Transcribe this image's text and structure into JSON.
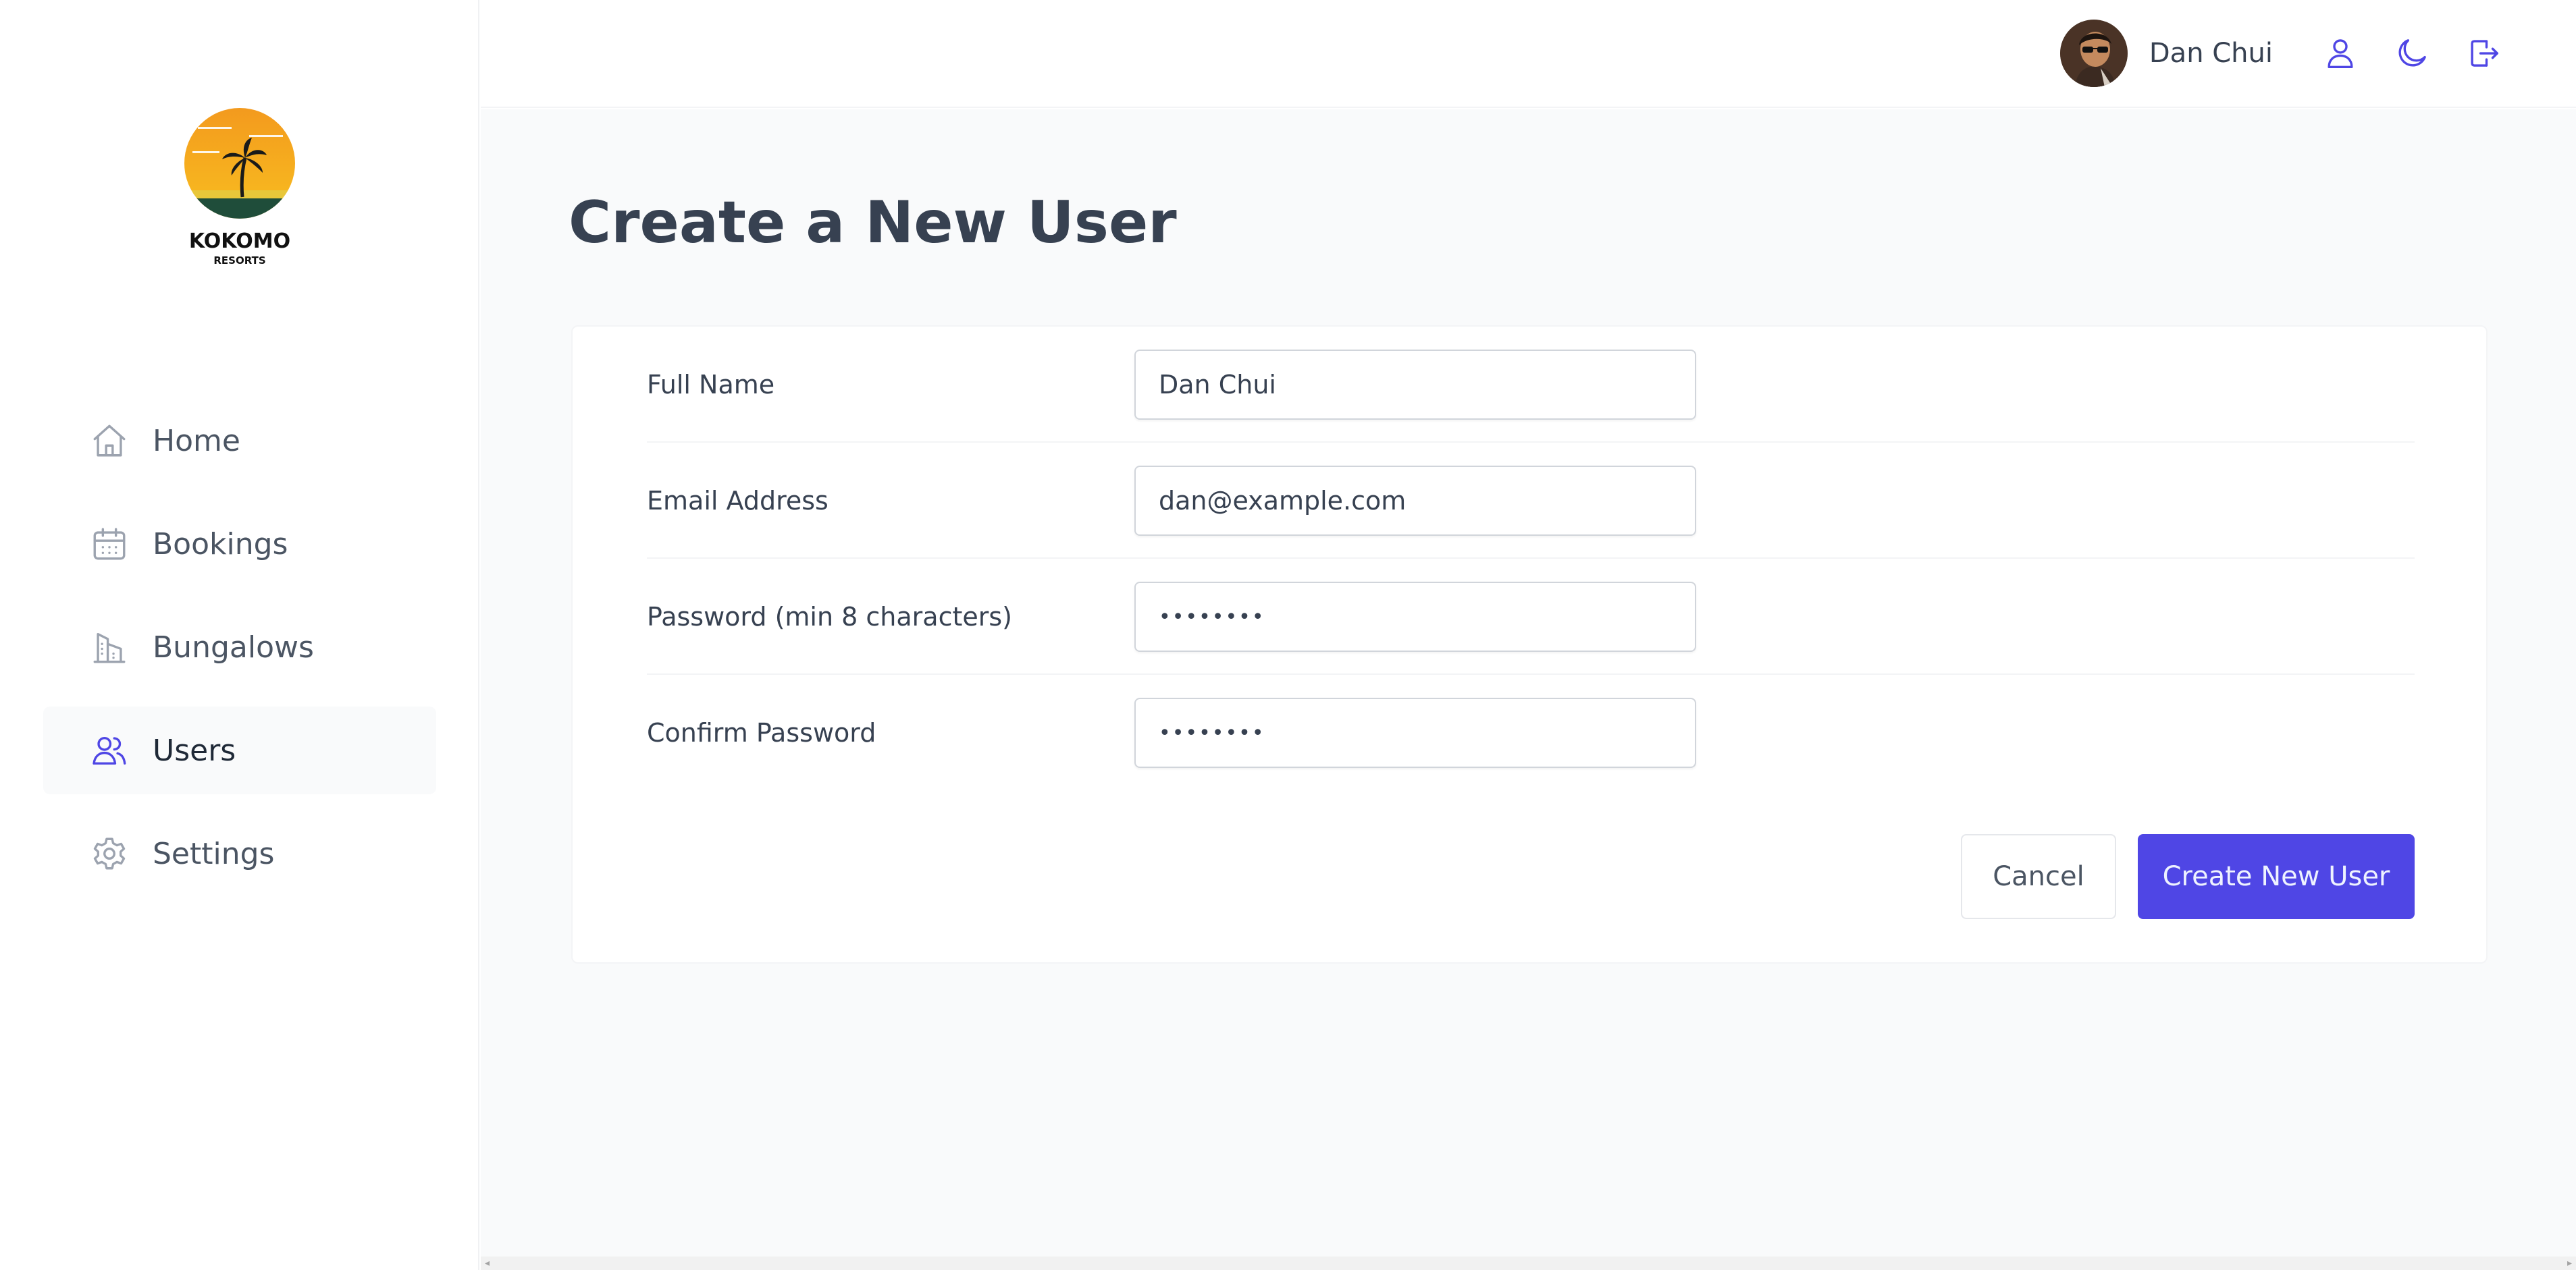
{
  "brand": {
    "name": "KOKOMO",
    "tagline": "RESORTS"
  },
  "sidebar": {
    "items": [
      {
        "label": "Home",
        "icon": "home-icon",
        "active": false
      },
      {
        "label": "Bookings",
        "icon": "calendar-icon",
        "active": false
      },
      {
        "label": "Bungalows",
        "icon": "building-icon",
        "active": false
      },
      {
        "label": "Users",
        "icon": "users-icon",
        "active": true
      },
      {
        "label": "Settings",
        "icon": "gear-icon",
        "active": false
      }
    ]
  },
  "header": {
    "user_name": "Dan Chui",
    "actions": [
      "user-icon",
      "moon-icon",
      "logout-icon"
    ]
  },
  "page": {
    "title": "Create a New User"
  },
  "form": {
    "fields": [
      {
        "label": "Full Name",
        "value": "Dan Chui",
        "type": "text"
      },
      {
        "label": "Email Address",
        "value": "dan@example.com",
        "type": "email"
      },
      {
        "label": "Password (min 8 characters)",
        "value": "••••••••",
        "type": "password"
      },
      {
        "label": "Confirm Password",
        "value": "••••••••",
        "type": "password"
      }
    ],
    "cancel_label": "Cancel",
    "submit_label": "Create New User"
  },
  "colors": {
    "accent": "#4f46e5",
    "text": "#374151",
    "background": "#f9fafb"
  }
}
